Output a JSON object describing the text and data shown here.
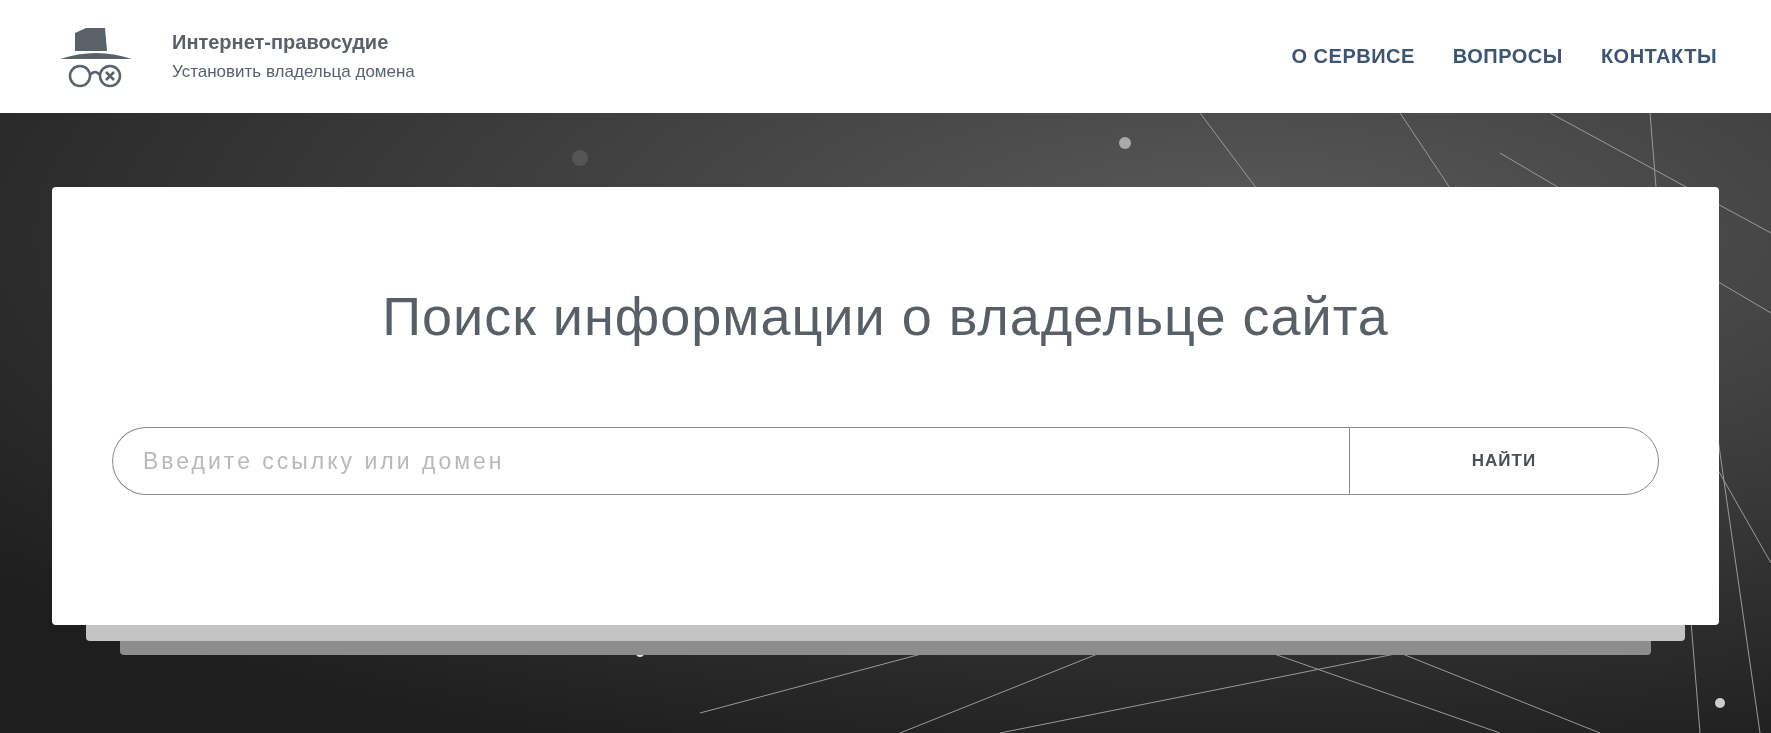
{
  "header": {
    "title": "Интернет-правосудие",
    "subtitle": "Установить владельца домена"
  },
  "nav": [
    {
      "label": "О СЕРВИСЕ"
    },
    {
      "label": "ВОПРОСЫ"
    },
    {
      "label": "КОНТАКТЫ"
    }
  ],
  "search_card": {
    "heading": "Поиск информации о владельце сайта",
    "search": {
      "placeholder": "Введите ссылку или домен"
    },
    "button": "НАЙТИ"
  }
}
